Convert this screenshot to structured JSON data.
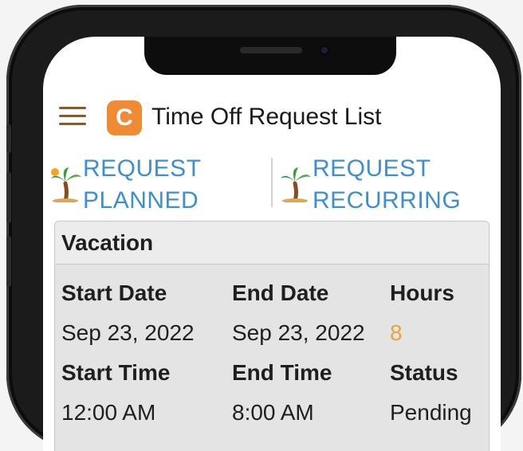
{
  "header": {
    "title": "Time Off Request List",
    "logo_letter": "C"
  },
  "actions": [
    {
      "line1": "REQUEST",
      "line2": "PLANNED"
    },
    {
      "line1": "REQUEST",
      "line2": "RECURRING"
    }
  ],
  "card": {
    "title": "Vacation",
    "labels": {
      "start_date": "Start Date",
      "end_date": "End Date",
      "hours": "Hours",
      "start_time": "Start Time",
      "end_time": "End Time",
      "status": "Status"
    },
    "values": {
      "start_date": "Sep 23, 2022",
      "end_date": "Sep 23, 2022",
      "hours": "8",
      "start_time": "12:00 AM",
      "end_time": "8:00 AM",
      "status": "Pending"
    }
  },
  "colors": {
    "link": "#3c8fd1",
    "menu": "#8a5a2b",
    "logo": "#f08a35",
    "hours": "#e8a33a"
  },
  "icons": [
    "hamburger-menu-icon",
    "app-logo-icon",
    "palm-tree-icon"
  ]
}
